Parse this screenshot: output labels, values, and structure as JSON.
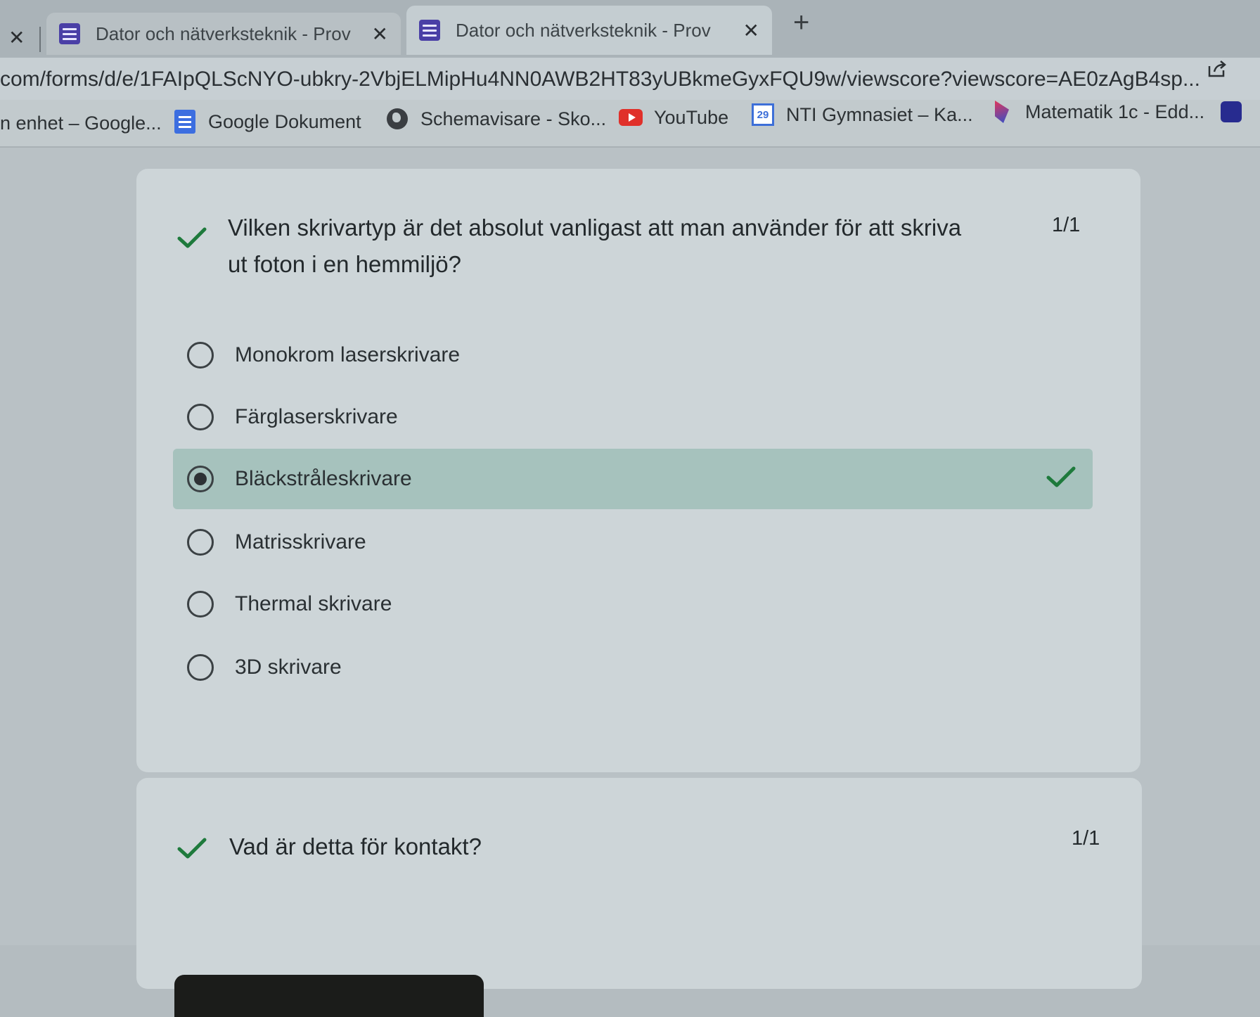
{
  "browser": {
    "tabs": [
      {
        "title": "Dator och nätverksteknik - Prov",
        "active": false
      },
      {
        "title": "Dator och nätverksteknik - Prov",
        "active": true
      }
    ],
    "new_tab_label": "+",
    "close_label": "✕",
    "url": "com/forms/d/e/1FAIpQLScNYO-ubkry-2VbjELMipHu4NN0AWB2HT83yUBkmeGyxFQU9w/viewscore?viewscore=AE0zAgB4sp...",
    "bookmarks": [
      {
        "label": "n enhet – Google...",
        "icon": "none"
      },
      {
        "label": "Google Dokument",
        "icon": "docs-icon"
      },
      {
        "label": "Schemavisare - Sko...",
        "icon": "globe-icon"
      },
      {
        "label": "YouTube",
        "icon": "youtube-icon"
      },
      {
        "label": "NTI Gymnasiet – Ka...",
        "icon": "calendar-icon",
        "icon_text": "29"
      },
      {
        "label": "Matematik 1c - Edd...",
        "icon": "eddler-icon"
      }
    ]
  },
  "questions": [
    {
      "text_line1": "Vilken skrivartyp är det absolut vanligast att man använder för att skriva",
      "text_line2": "ut foton i en hemmiljö?",
      "score": "1/1",
      "options": [
        {
          "label": "Monokrom laserskrivare",
          "selected": false,
          "correct": false
        },
        {
          "label": "Färglaserskrivare",
          "selected": false,
          "correct": false
        },
        {
          "label": "Bläckstråleskrivare",
          "selected": true,
          "correct": true
        },
        {
          "label": "Matrisskrivare",
          "selected": false,
          "correct": false
        },
        {
          "label": "Thermal skrivare",
          "selected": false,
          "correct": false
        },
        {
          "label": "3D skrivare",
          "selected": false,
          "correct": false
        }
      ]
    },
    {
      "text_line1": "Vad är detta för kontakt?",
      "score": "1/1"
    }
  ],
  "colors": {
    "correct_highlight": "#a6c2bd",
    "check_green": "#1e7a3c",
    "forms_purple": "#4a3fa6"
  }
}
